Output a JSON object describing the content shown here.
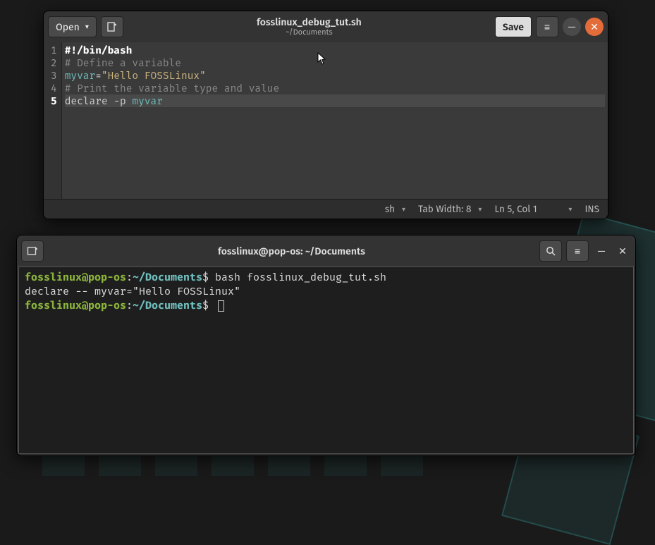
{
  "editor": {
    "open_label": "Open",
    "filename": "fosslinux_debug_tut.sh",
    "filepath": "~/Documents",
    "save_label": "Save",
    "code_lines": [
      {
        "n": 1,
        "segments": [
          {
            "cls": "tok-keyword",
            "t": "#!/bin/bash"
          }
        ]
      },
      {
        "n": 2,
        "segments": [
          {
            "cls": "tok-comment",
            "t": "# Define a variable"
          }
        ]
      },
      {
        "n": 3,
        "segments": [
          {
            "cls": "tok-var",
            "t": "myvar"
          },
          {
            "cls": "tok-op",
            "t": "="
          },
          {
            "cls": "tok-string",
            "t": "\"Hello FOSSLinux\""
          }
        ]
      },
      {
        "n": 4,
        "segments": [
          {
            "cls": "tok-comment",
            "t": "# Print the variable type and value"
          }
        ]
      },
      {
        "n": 5,
        "current": true,
        "segments": [
          {
            "cls": "tok-plain",
            "t": "declare -p "
          },
          {
            "cls": "tok-var",
            "t": "myvar"
          }
        ]
      }
    ],
    "status": {
      "lang": "sh",
      "tab_width": "Tab Width: 8",
      "position": "Ln 5, Col 1",
      "insert": "INS"
    }
  },
  "terminal": {
    "title": "fosslinux@pop-os: ~/Documents",
    "lines": [
      {
        "segments": [
          {
            "cls": "t-user",
            "t": "fosslinux@pop-os"
          },
          {
            "cls": "t-plain",
            "t": ":"
          },
          {
            "cls": "t-path",
            "t": "~/Documents"
          },
          {
            "cls": "t-plain",
            "t": "$ bash fosslinux_debug_tut.sh"
          }
        ]
      },
      {
        "segments": [
          {
            "cls": "t-plain",
            "t": "declare -- myvar=\"Hello FOSSLinux\""
          }
        ]
      },
      {
        "segments": [
          {
            "cls": "t-user",
            "t": "fosslinux@pop-os"
          },
          {
            "cls": "t-plain",
            "t": ":"
          },
          {
            "cls": "t-path",
            "t": "~/Documents"
          },
          {
            "cls": "t-plain",
            "t": "$ "
          }
        ],
        "cursor": true
      }
    ]
  },
  "icons": {
    "dropdown": "▾",
    "new_tab": "⊞",
    "menu": "≡",
    "minimize": "—",
    "close": "✕",
    "search": "🔍"
  }
}
